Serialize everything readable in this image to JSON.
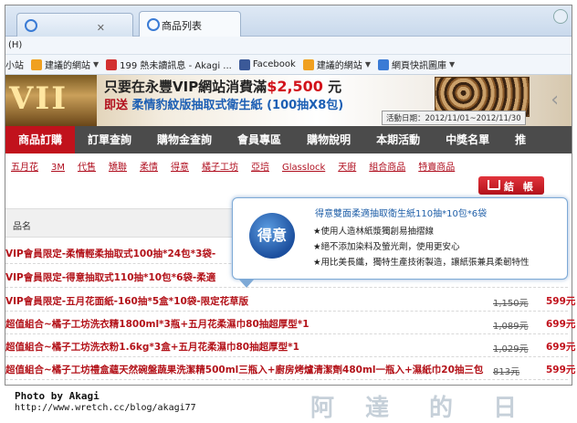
{
  "browser": {
    "tab_inactive": "",
    "tab_active": "商品列表",
    "menu_text": "(H)",
    "favorites": [
      {
        "label": "小站",
        "caret": false,
        "icon_color": "#ffffff"
      },
      {
        "label": "建議的網站",
        "caret": true,
        "icon_color": "#f0a020"
      },
      {
        "label": "199 熱未讀訊息 - Akagi ...",
        "caret": false,
        "icon_color": "#d23030"
      },
      {
        "label": "Facebook",
        "caret": false,
        "icon_color": "#3b5998"
      },
      {
        "label": "建議的網站",
        "caret": true,
        "icon_color": "#f0a020"
      },
      {
        "label": "網頁快訊圖庫",
        "caret": true,
        "icon_color": "#3a7bd5"
      }
    ]
  },
  "banner": {
    "emblem": "VII",
    "line1_prefix": "只要在永豐VIP網站消費滿",
    "line1_amount": "$2,500",
    "line1_suffix": "元",
    "line2_prefix": "即送",
    "line2_product": "柔情豹紋版抽取式衛生紙",
    "line2_detail": "(100抽X8包)",
    "date": "活動日期：2012/11/01~2012/11/30",
    "arrow": "‹"
  },
  "nav": {
    "items": [
      "商品訂購",
      "訂單查詢",
      "購物金查詢",
      "會員專區",
      "購物說明",
      "本期活動",
      "中獎名單",
      "推"
    ],
    "active_index": 0,
    "active_color": "#c1121c"
  },
  "brands": [
    "五月花",
    "3M",
    "代售",
    "矯聯",
    "柔情",
    "得意",
    "橘子工坊",
    "亞培",
    "Glasslock",
    "天廚",
    "組合商品",
    "特賣商品"
  ],
  "settle_label": "結 帳",
  "table": {
    "header": "品名",
    "rows": [
      {
        "name": "VIP會員限定-柔情輕柔抽取式100抽*24包*3袋-",
        "orig": "",
        "price": ""
      },
      {
        "name": "VIP會員限定-得意抽取式110抽*10包*6袋-柔適",
        "orig": "",
        "price": ""
      },
      {
        "name": "VIP會員限定-五月花面紙-160抽*5盒*10袋-限定花草版",
        "orig": "1,150元",
        "price": "599元"
      },
      {
        "name": "超值組合~橘子工坊洗衣精1800ml*3瓶+五月花柔濕巾80抽超厚型*1",
        "orig": "1,089元",
        "price": "699元"
      },
      {
        "name": "超值組合~橘子工坊洗衣粉1.6kg*3盒+五月花柔濕巾80抽超厚型*1",
        "orig": "1,029元",
        "price": "699元"
      },
      {
        "name": "超值組合~橘子工坊禮盒蘊天然碗盤蔬果洗潔精500ml三瓶入+廚房烤爐清潔劑480ml一瓶入+濕紙巾20抽三包",
        "orig": "813元",
        "price": "599元"
      }
    ]
  },
  "popup": {
    "title": "得意雙面柔適抽取衛生紙110抽*10包*6袋",
    "logo_text": "得意",
    "bullets": [
      "★使用人造林紙漿獨創易抽摺線",
      "★絕不添加染料及螢光劑，使用更安心",
      "★用比美長纖，獨特生產技術製造，讓紙張兼具柔韌特性"
    ]
  },
  "footer": {
    "photo_by": "Photo by Akagi",
    "url": "http://www.wretch.cc/blog/akagi77"
  }
}
